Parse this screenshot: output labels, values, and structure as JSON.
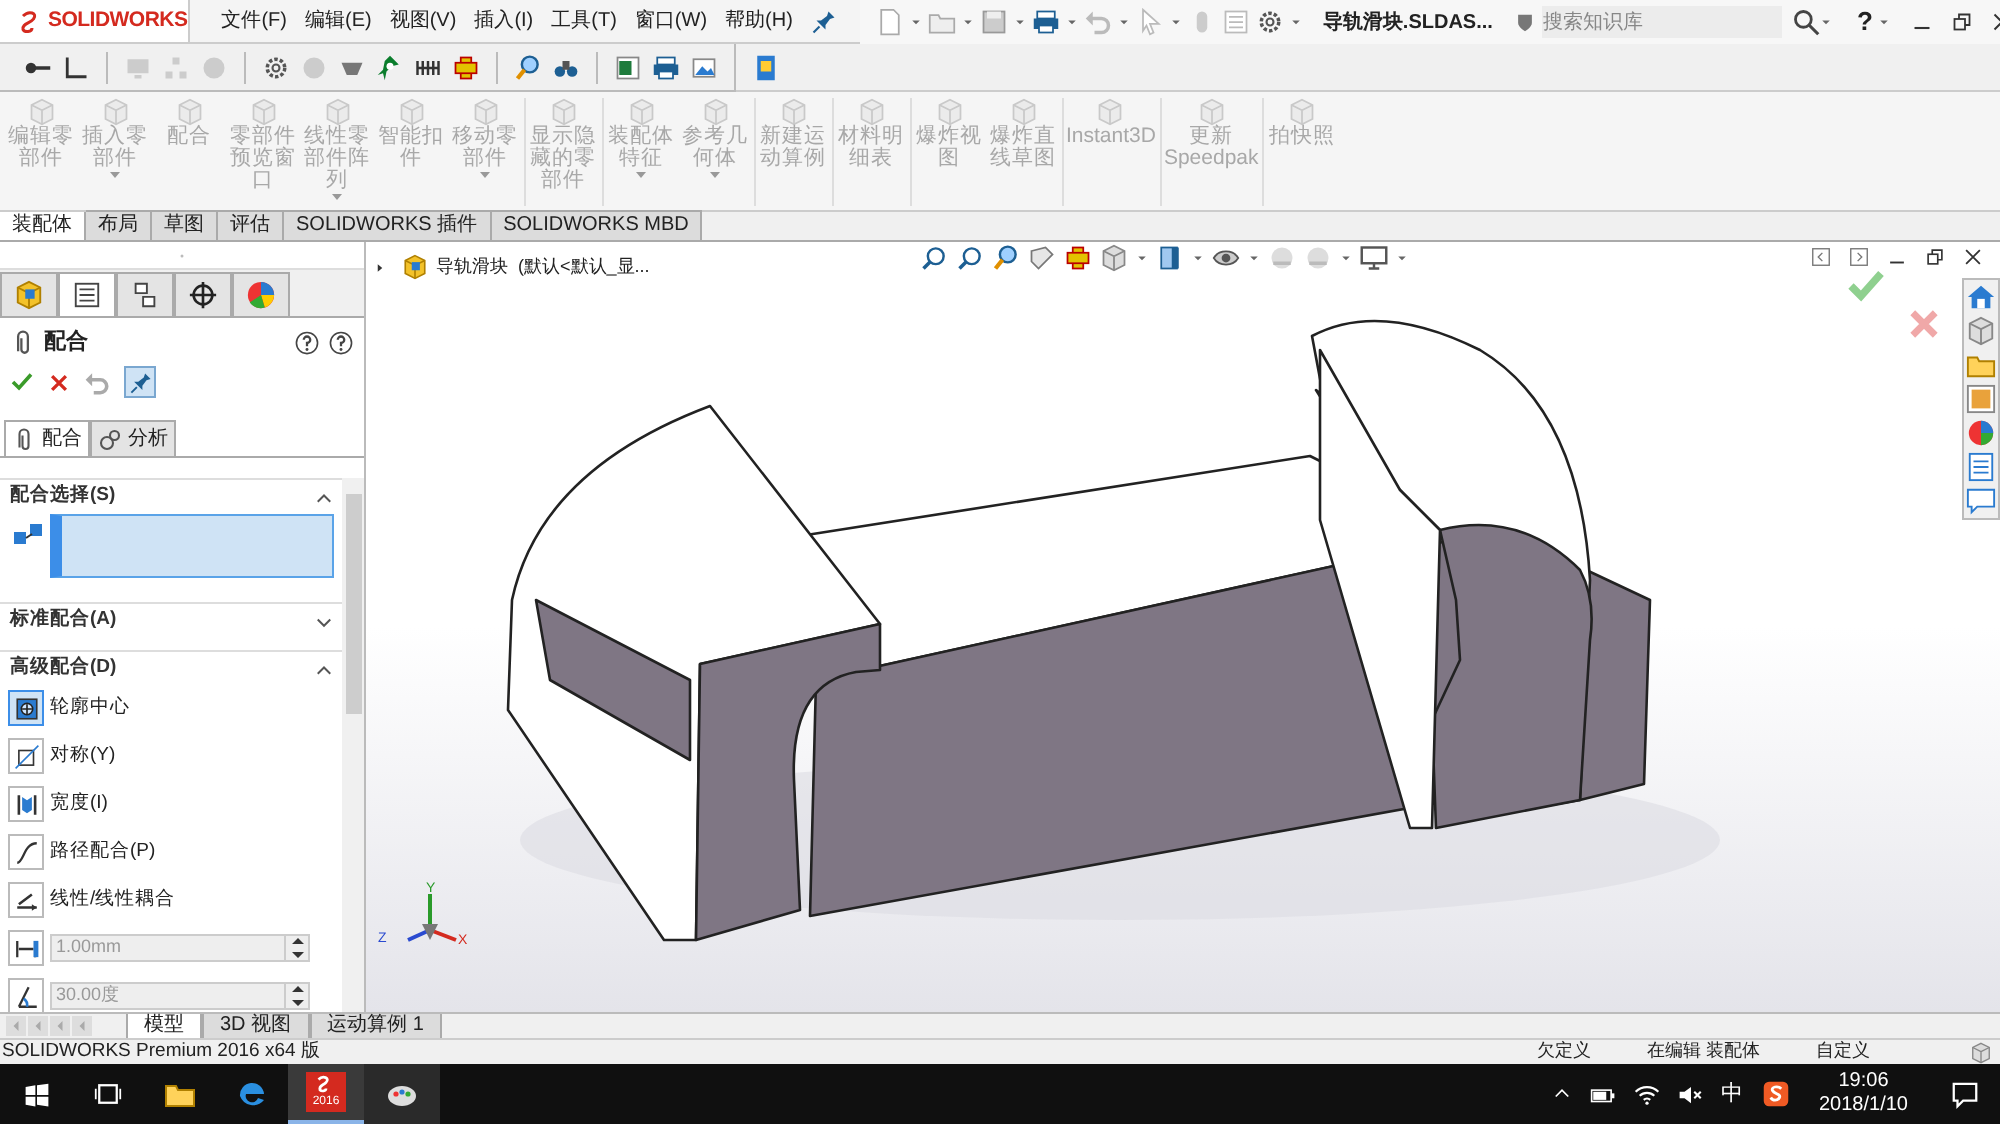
{
  "title_bar": {
    "logo": "SOLIDWORKS",
    "menu": [
      "文件(F)",
      "编辑(E)",
      "视图(V)",
      "插入(I)",
      "工具(T)",
      "窗口(W)",
      "帮助(H)"
    ],
    "document_title": "导轨滑块.SLDAS...",
    "search": {
      "placeholder": "搜索知识库"
    },
    "help": "?"
  },
  "command_manager": [
    {
      "label": "编辑零部件",
      "disabled": true,
      "dropdown": false,
      "separator_before": false
    },
    {
      "label": "插入零部件",
      "disabled": true,
      "dropdown": true,
      "separator_before": false
    },
    {
      "label": "配合",
      "disabled": true,
      "dropdown": false,
      "separator_before": false
    },
    {
      "label": "零部件预览窗口",
      "disabled": true,
      "dropdown": false,
      "separator_before": false
    },
    {
      "label": "线性零部件阵列",
      "disabled": true,
      "dropdown": true,
      "separator_before": false
    },
    {
      "label": "智能扣件",
      "disabled": true,
      "dropdown": false,
      "separator_before": false
    },
    {
      "label": "移动零部件",
      "disabled": true,
      "dropdown": true,
      "separator_before": false
    },
    {
      "label": "显示隐藏的零部件",
      "disabled": true,
      "dropdown": false,
      "separator_before": true
    },
    {
      "label": "装配体特征",
      "disabled": true,
      "dropdown": true,
      "separator_before": true
    },
    {
      "label": "参考几何体",
      "disabled": true,
      "dropdown": true,
      "separator_before": false
    },
    {
      "label": "新建运动算例",
      "disabled": true,
      "dropdown": false,
      "separator_before": true
    },
    {
      "label": "材料明细表",
      "disabled": true,
      "dropdown": false,
      "separator_before": true
    },
    {
      "label": "爆炸视图",
      "disabled": true,
      "dropdown": false,
      "separator_before": true
    },
    {
      "label": "爆炸直线草图",
      "disabled": true,
      "dropdown": false,
      "separator_before": false
    },
    {
      "label": "Instant3D",
      "disabled": true,
      "dropdown": false,
      "separator_before": true
    },
    {
      "label": "更新Speedpak",
      "disabled": true,
      "dropdown": false,
      "separator_before": true
    },
    {
      "label": "拍快照",
      "disabled": true,
      "dropdown": false,
      "separator_before": true
    }
  ],
  "tabs": [
    {
      "label": "装配体",
      "selected": true
    },
    {
      "label": "布局",
      "selected": false
    },
    {
      "label": "草图",
      "selected": false
    },
    {
      "label": "评估",
      "selected": false
    },
    {
      "label": "SOLIDWORKS 插件",
      "selected": false
    },
    {
      "label": "SOLIDWORKS MBD",
      "selected": false
    }
  ],
  "property_manager": {
    "title": "配合",
    "subtabs": [
      {
        "label": "配合",
        "selected": true
      },
      {
        "label": "分析",
        "selected": false
      }
    ],
    "sections": [
      {
        "title": "配合选择(S)",
        "expanded": true
      },
      {
        "title": "标准配合(A)",
        "expanded": false
      },
      {
        "title": "高级配合(D)",
        "expanded": true
      }
    ],
    "advanced_mates": [
      {
        "kind": "option",
        "label": "轮廓中心",
        "selected": true
      },
      {
        "kind": "option",
        "label": "对称(Y)",
        "selected": false
      },
      {
        "kind": "option",
        "label": "宽度(I)",
        "selected": false
      },
      {
        "kind": "option",
        "label": "路径配合(P)",
        "selected": false
      },
      {
        "kind": "option",
        "label": "线性/线性耦合",
        "selected": false
      },
      {
        "kind": "spinner",
        "value": "1.00mm",
        "disabled": true
      },
      {
        "kind": "spinner",
        "value": "30.00度",
        "disabled": true
      }
    ]
  },
  "feature_manager_tabs": [
    {
      "selected": false
    },
    {
      "selected": true
    },
    {
      "selected": false
    },
    {
      "selected": false
    },
    {
      "selected": false
    }
  ],
  "tree_root": "导轨滑块  (默认<默认_显...",
  "triad": {
    "x": "X",
    "y": "Y",
    "z": "Z"
  },
  "bottom_tabs": [
    {
      "label": "模型",
      "selected": true
    },
    {
      "label": "3D 视图",
      "selected": false
    },
    {
      "label": "运动算例 1",
      "selected": false
    }
  ],
  "status_bar": {
    "left": "SOLIDWORKS Premium 2016 x64 版",
    "right": [
      "欠定义",
      "在编辑 装配体",
      "自定义"
    ]
  },
  "taskbar": {
    "app_version": "2016",
    "ime": "中",
    "time": "19:06",
    "date": "2018/1/10"
  }
}
